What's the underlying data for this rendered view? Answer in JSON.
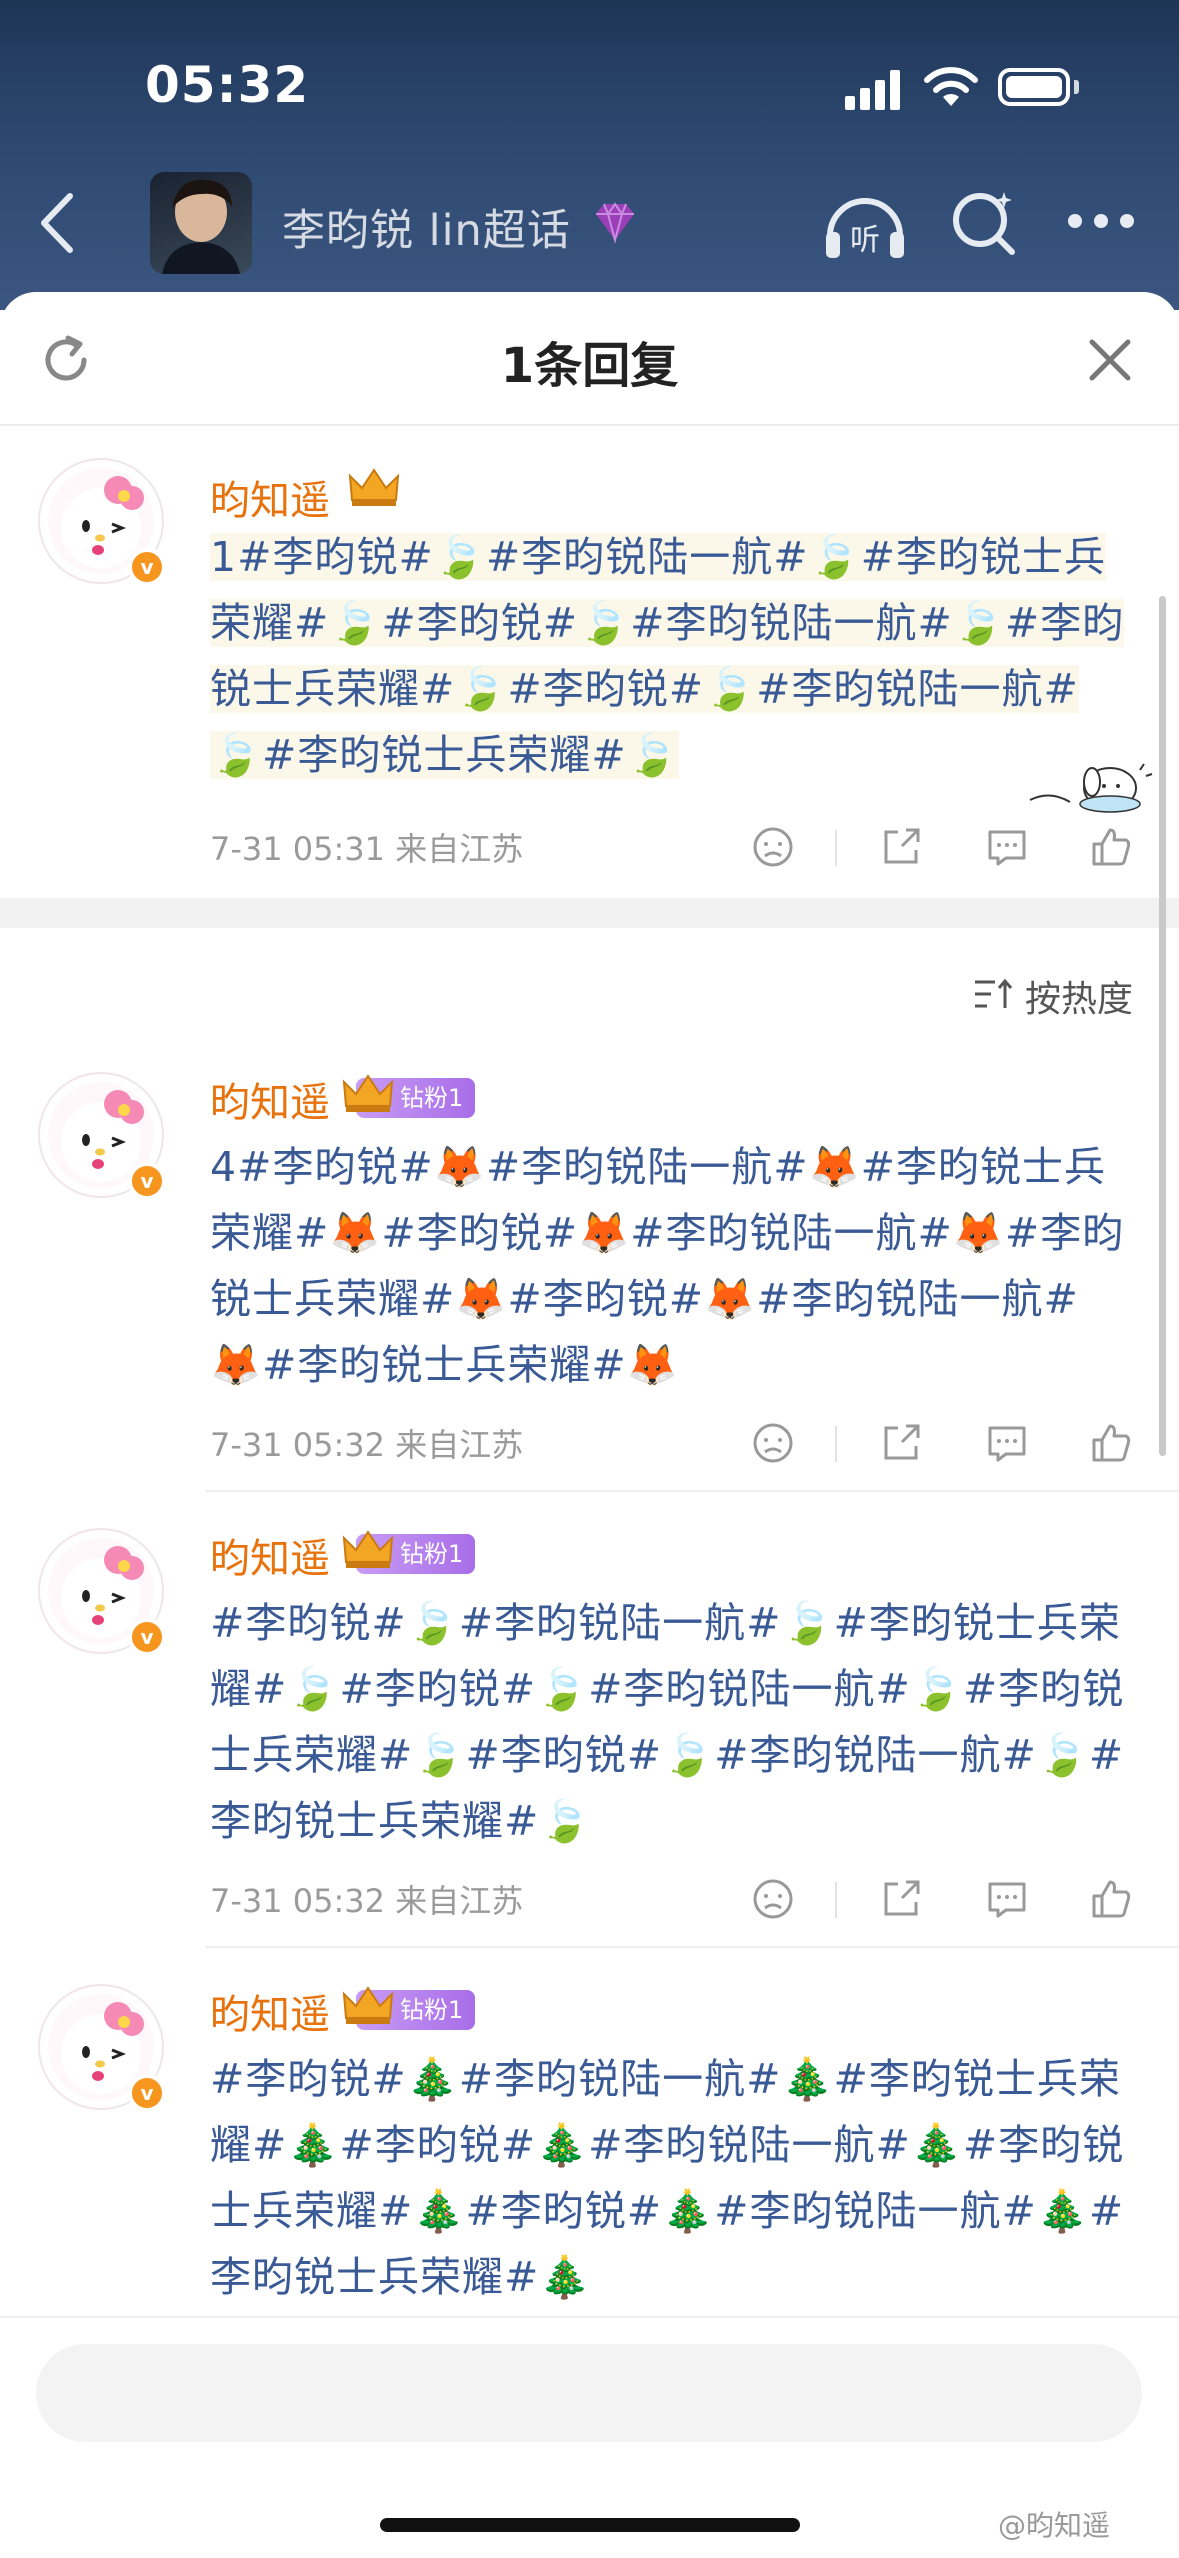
{
  "status_bar": {
    "time": "05:32"
  },
  "topic_header": {
    "title": "李昀锐 lin超话"
  },
  "sheet": {
    "title": "1条回复"
  },
  "sort": {
    "label": "按热度"
  },
  "root_comment": {
    "username": "昀知遥",
    "text": "1#李昀锐#🍃#李昀锐陆一航#🍃#李昀锐士兵荣耀#🍃#李昀锐#🍃#李昀锐陆一航#🍃#李昀锐士兵荣耀#🍃#李昀锐#🍃#李昀锐陆一航#🍃#李昀锐士兵荣耀#🍃",
    "meta": "7-31 05:31 来自江苏"
  },
  "replies": [
    {
      "username": "昀知遥",
      "fan_badge": "钻粉1",
      "text": "4#李昀锐#🦊#李昀锐陆一航#🦊#李昀锐士兵荣耀#🦊#李昀锐#🦊#李昀锐陆一航#🦊#李昀锐士兵荣耀#🦊#李昀锐#🦊#李昀锐陆一航#🦊#李昀锐士兵荣耀#🦊",
      "meta": "7-31 05:32 来自江苏"
    },
    {
      "username": "昀知遥",
      "fan_badge": "钻粉1",
      "text": "#李昀锐#🍃#李昀锐陆一航#🍃#李昀锐士兵荣耀#🍃#李昀锐#🍃#李昀锐陆一航#🍃#李昀锐士兵荣耀#🍃#李昀锐#🍃#李昀锐陆一航#🍃#李昀锐士兵荣耀#🍃",
      "meta": "7-31 05:32 来自江苏"
    },
    {
      "username": "昀知遥",
      "fan_badge": "钻粉1",
      "text": "#李昀锐#🎄#李昀锐陆一航#🎄#李昀锐士兵荣耀#🎄#李昀锐#🎄#李昀锐陆一航#🎄#李昀锐士兵荣耀#🎄#李昀锐#🎄#李昀锐陆一航#🎄#李昀锐士兵荣耀#🎄"
    }
  ],
  "input": {
    "placeholder": "",
    "watermark": "@昀知遥"
  },
  "colors": {
    "username": "#e8720c",
    "topic_link": "#3a5a96",
    "header_bg": "#2d4870",
    "fan_badge": "#b07ae8"
  }
}
